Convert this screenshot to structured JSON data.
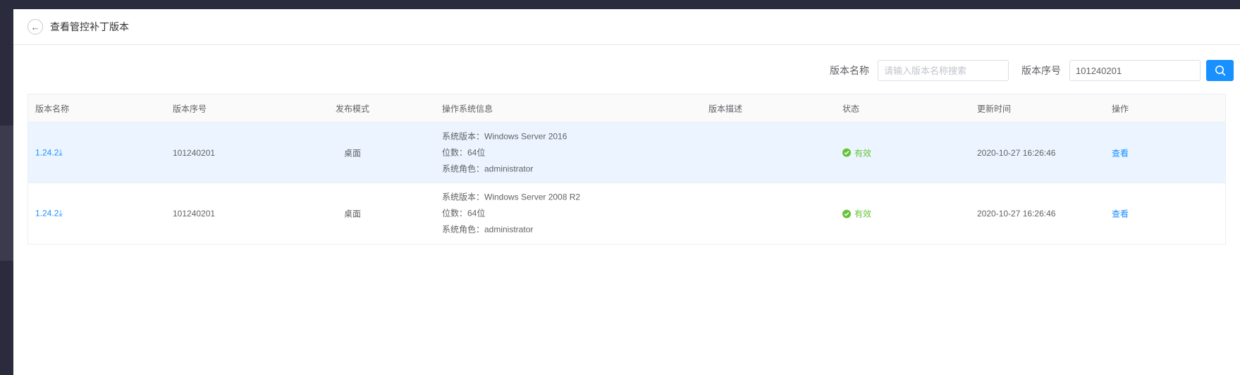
{
  "header": {
    "title": "查看管控补丁版本"
  },
  "search": {
    "name_label": "版本名称",
    "name_placeholder": "请输入版本名称搜索",
    "name_value": "",
    "seq_label": "版本序号",
    "seq_value": "101240201"
  },
  "table": {
    "columns": [
      "版本名称",
      "版本序号",
      "发布模式",
      "操作系统信息",
      "版本描述",
      "状态",
      "更新时间",
      "操作"
    ],
    "rows": [
      {
        "name": "1.24.2",
        "seq": "101240201",
        "mode": "桌面",
        "os_version": "系统版本：Windows Server 2016",
        "os_bits": "位数：64位",
        "os_role": "系统角色：administrator",
        "desc": "",
        "status": "有效",
        "updated": "2020-10-27 16:26:46",
        "action": "查看"
      },
      {
        "name": "1.24.2",
        "seq": "101240201",
        "mode": "桌面",
        "os_version": "系统版本：Windows Server 2008 R2",
        "os_bits": "位数：64位",
        "os_role": "系统角色：administrator",
        "desc": "",
        "status": "有效",
        "updated": "2020-10-27 16:26:46",
        "action": "查看"
      }
    ]
  },
  "colors": {
    "accent": "#1890ff",
    "success": "#67c23a",
    "row_highlight": "#ecf5ff"
  }
}
